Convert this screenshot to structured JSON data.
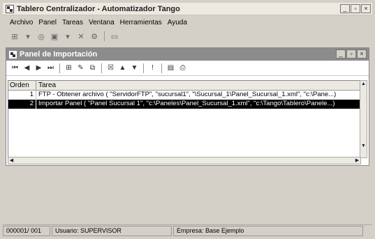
{
  "window": {
    "title": "Tablero Centralizador - Automatizador Tango"
  },
  "menu": [
    "Archivo",
    "Panel",
    "Tareas",
    "Ventana",
    "Herramientas",
    "Ayuda"
  ],
  "child": {
    "title": "Panel de Importación"
  },
  "grid": {
    "headers": [
      "Orden",
      "Tarea"
    ],
    "rows": [
      {
        "orden": "1",
        "tarea": "FTP - Obtener archivo ( \"ServidorFTP\", \"sucursal1\", \"\\Sucursal_1\\Panel_Sucursal_1.xml\", \"c:\\Pane...)"
      },
      {
        "orden": "2",
        "tarea": "Importar Panel ( \"Panel Sucursal 1\", \"c:\\Paneles\\Panel_Sucursal_1.xml\", \"c:\\Tango\\Tablero\\Panele...)"
      }
    ]
  },
  "status": {
    "record": "000001/ 001",
    "user": "Usuario: SUPERVISOR",
    "company": "Empresa: Base Ejemplo"
  }
}
